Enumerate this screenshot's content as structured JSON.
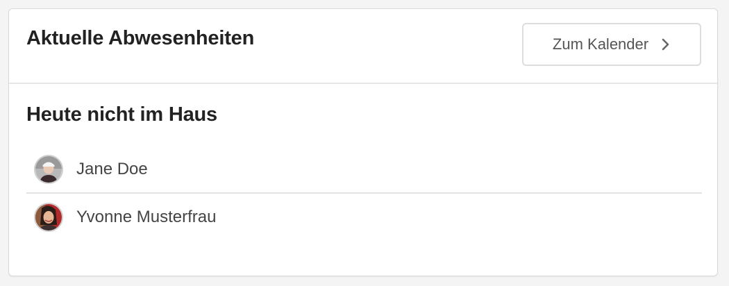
{
  "card": {
    "title": "Aktuelle Abwesenheiten",
    "calendar_button_label": "Zum Kalender",
    "calendar_button_icon": "chevron-right-icon"
  },
  "section": {
    "title": "Heute nicht im Haus"
  },
  "people": [
    {
      "name": "Jane Doe",
      "avatar": "avatar-jane-doe"
    },
    {
      "name": "Yvonne Musterfrau",
      "avatar": "avatar-yvonne-musterfrau"
    }
  ],
  "colors": {
    "card_background": "#ffffff",
    "page_background": "#f4f4f4",
    "title_text": "#222222",
    "body_text": "#444444",
    "border": "#e3e3e3"
  }
}
